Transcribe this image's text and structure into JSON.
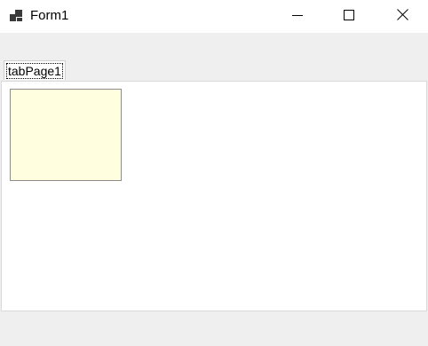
{
  "window": {
    "title": "Form1",
    "icon": "winforms-app-icon",
    "controls": {
      "minimize_icon": "minimize-icon",
      "maximize_icon": "maximize-icon",
      "close_icon": "close-icon"
    }
  },
  "tab_control": {
    "tabs": [
      {
        "label": "tabPage1",
        "selected": true
      }
    ]
  },
  "panel": {
    "background_color": "#ffffe0",
    "border_color": "#8c8c8c"
  }
}
